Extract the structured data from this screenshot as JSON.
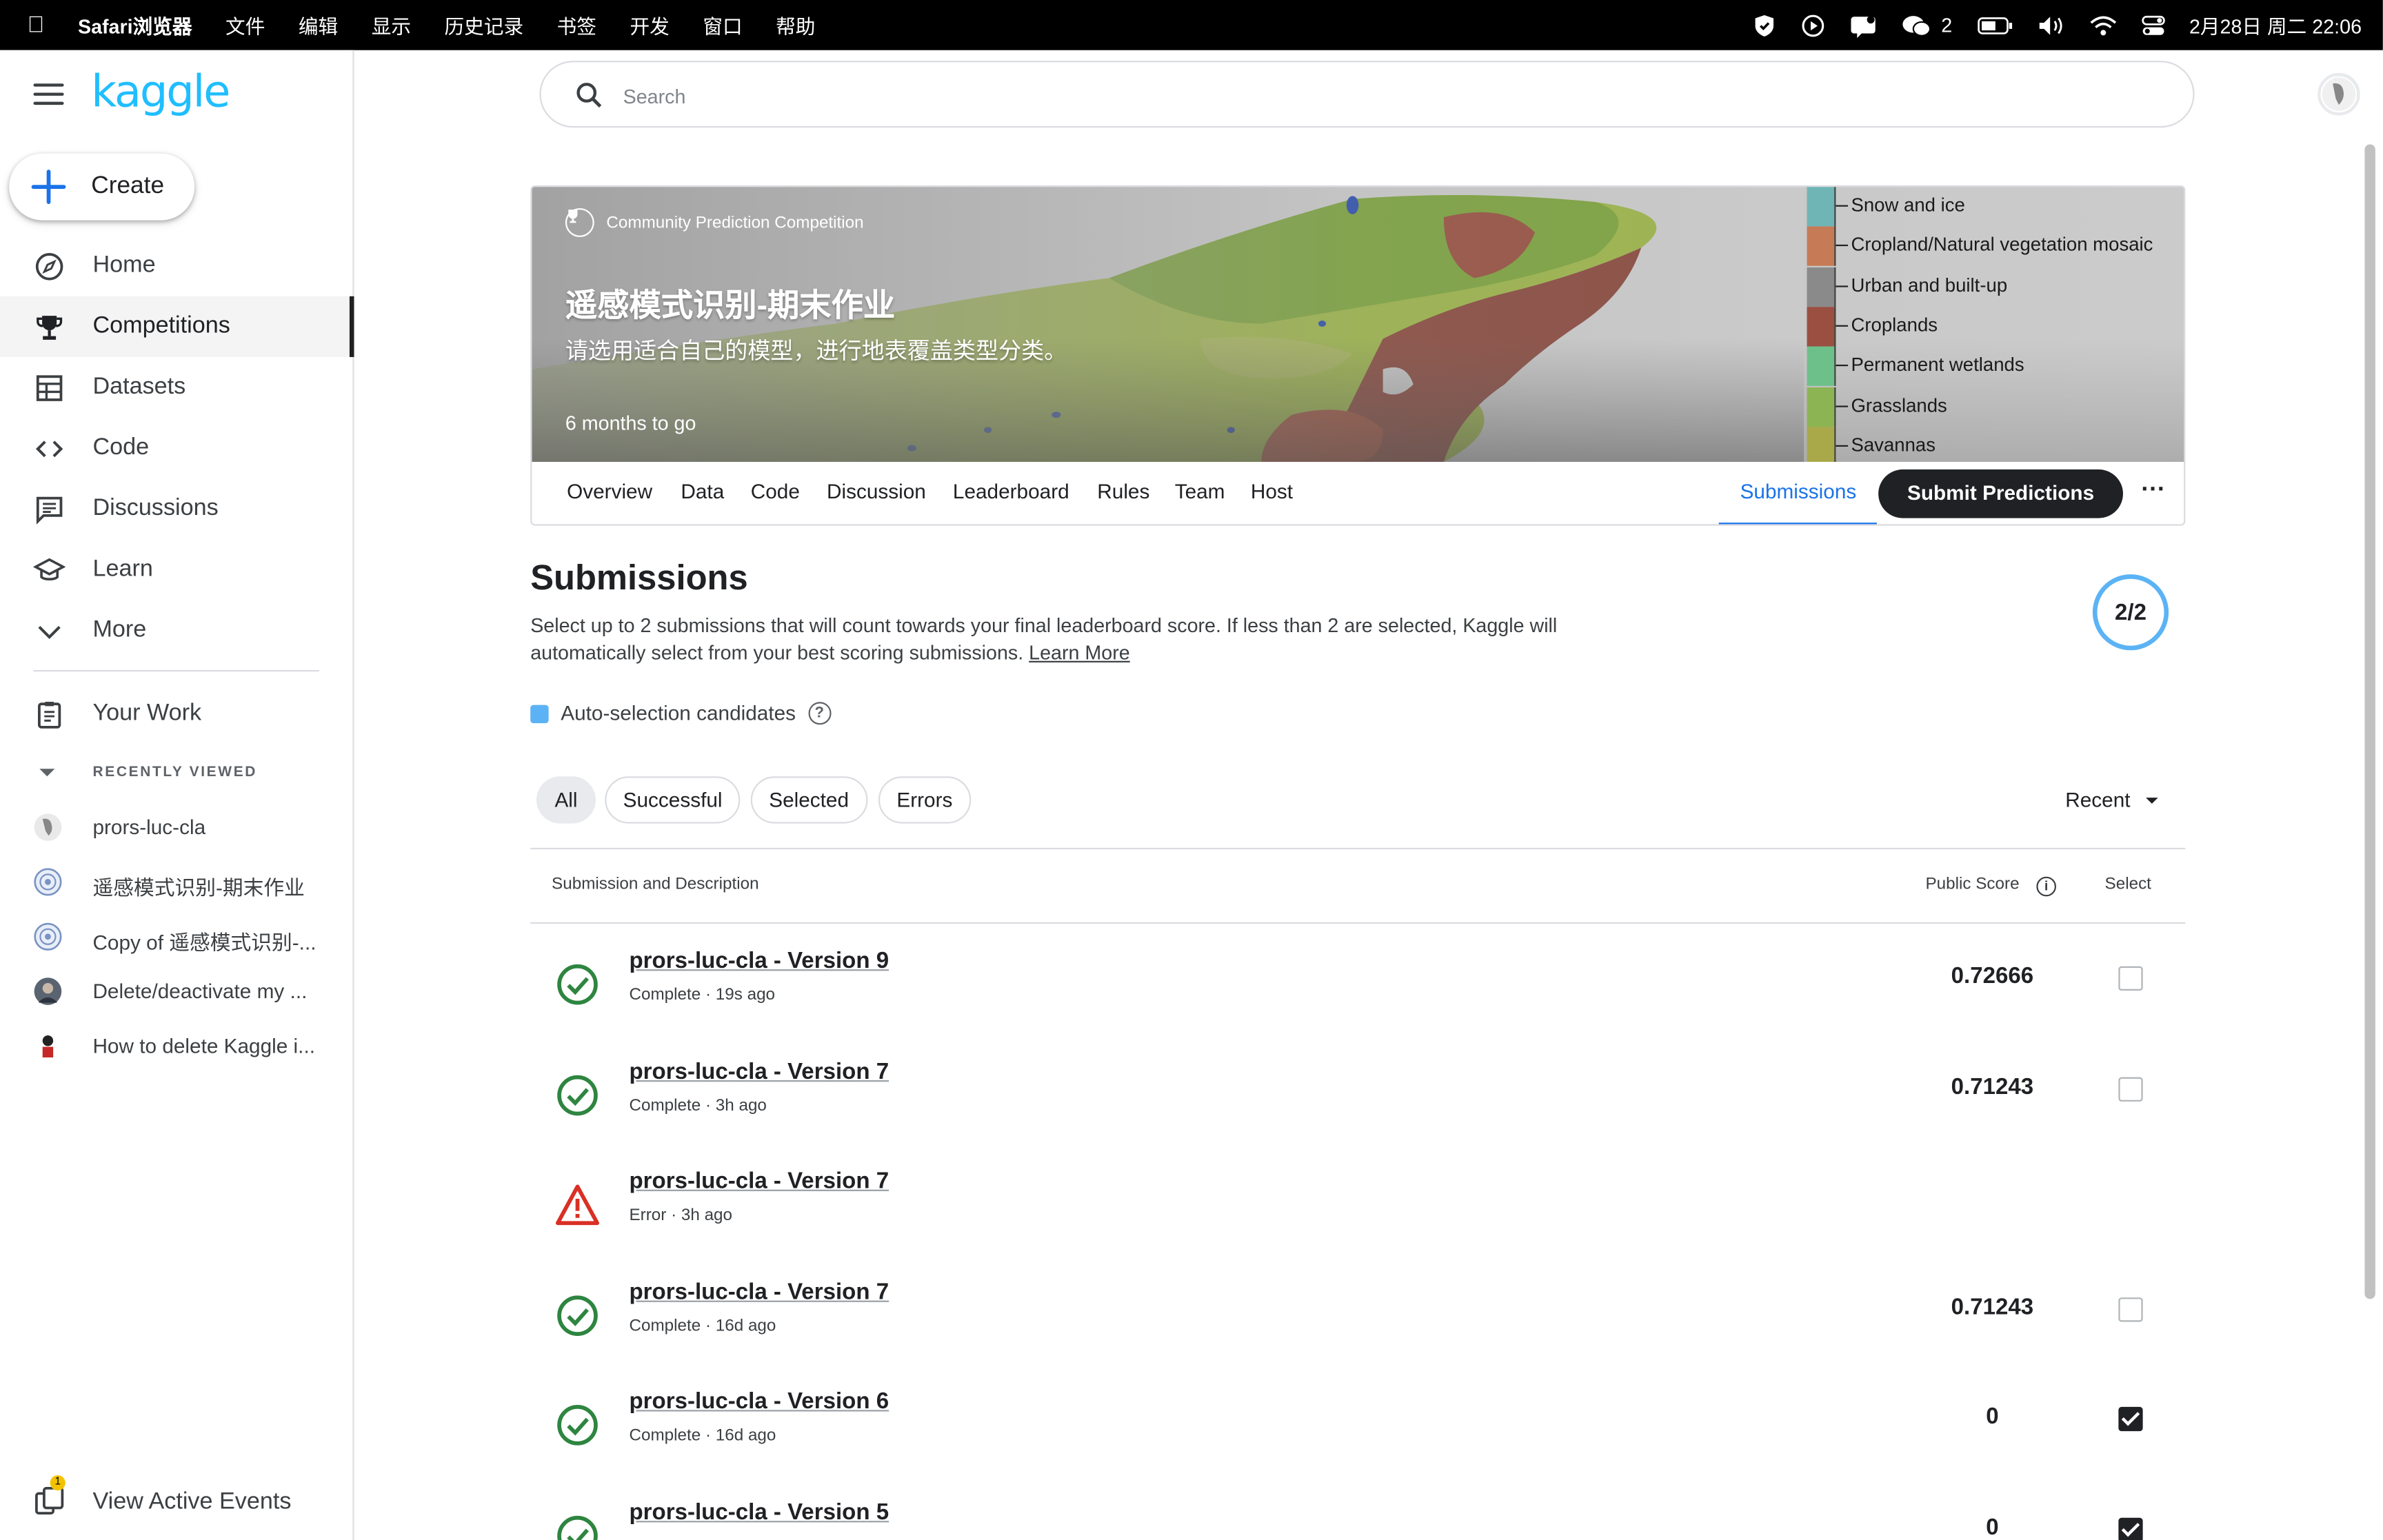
{
  "menubar": {
    "app": "Safari浏览器",
    "items": [
      "文件",
      "编辑",
      "显示",
      "历史记录",
      "书签",
      "开发",
      "窗口",
      "帮助"
    ],
    "wechat_badge": "2",
    "datetime": "2月28日 周二 22:06"
  },
  "sidebar": {
    "logo": "kaggle",
    "create_label": "Create",
    "nav": [
      {
        "label": "Home",
        "icon": "compass-icon"
      },
      {
        "label": "Competitions",
        "icon": "trophy-icon",
        "active": true
      },
      {
        "label": "Datasets",
        "icon": "table-icon"
      },
      {
        "label": "Code",
        "icon": "code-icon"
      },
      {
        "label": "Discussions",
        "icon": "chat-icon"
      },
      {
        "label": "Learn",
        "icon": "school-icon"
      },
      {
        "label": "More",
        "icon": "chevron-down-icon"
      }
    ],
    "your_work": "Your Work",
    "recently_viewed_heading": "RECENTLY VIEWED",
    "recent": [
      "prors-luc-cla",
      "遥感模式识别-期末作业",
      "Copy of 遥感模式识别-...",
      "Delete/deactivate my ...",
      "How to delete Kaggle i..."
    ],
    "view_active_events": "View Active Events",
    "events_badge": "1"
  },
  "search": {
    "placeholder": "Search"
  },
  "banner": {
    "type_label": "Community Prediction Competition",
    "title": "遥感模式识别-期末作业",
    "subtitle": "请选用适合自己的模型，进行地表覆盖类型分类。",
    "deadline": "6 months to go",
    "legend": [
      {
        "label": "Snow and ice",
        "color": "#6fb5b6"
      },
      {
        "label": "Cropland/Natural vegetation mosaic",
        "color": "#c57b56"
      },
      {
        "label": "Urban and built-up",
        "color": "#8a8a8a"
      },
      {
        "label": "Croplands",
        "color": "#9a4f40"
      },
      {
        "label": "Permanent wetlands",
        "color": "#6ec08a"
      },
      {
        "label": "Grasslands",
        "color": "#8db452"
      },
      {
        "label": "Savannas",
        "color": "#a9a94a"
      }
    ]
  },
  "tabs": {
    "items": [
      "Overview",
      "Data",
      "Code",
      "Discussion",
      "Leaderboard",
      "Rules",
      "Team",
      "Host"
    ],
    "active": "Submissions",
    "submit": "Submit Predictions"
  },
  "submissions": {
    "heading": "Submissions",
    "description": "Select up to 2 submissions that will count towards your final leaderboard score. If less than 2 are selected, Kaggle will automatically select from your best scoring submissions.",
    "learn_more": "Learn More",
    "selected_count": "2/2",
    "auto_selection": "Auto-selection candidates",
    "filters": [
      "All",
      "Successful",
      "Selected",
      "Errors"
    ],
    "sort": "Recent",
    "col_submission": "Submission and Description",
    "col_score": "Public Score",
    "col_select": "Select",
    "rows": [
      {
        "name": "prors-luc-cla - Version 9",
        "meta": "Complete · 19s ago",
        "score": "0.72666",
        "status": "complete",
        "selected": false
      },
      {
        "name": "prors-luc-cla - Version 7",
        "meta": "Complete · 3h ago",
        "score": "0.71243",
        "status": "complete",
        "selected": false
      },
      {
        "name": "prors-luc-cla - Version 7",
        "meta": "Error · 3h ago",
        "score": "",
        "status": "error",
        "selected": false
      },
      {
        "name": "prors-luc-cla - Version 7",
        "meta": "Complete · 16d ago",
        "score": "0.71243",
        "status": "complete",
        "selected": false
      },
      {
        "name": "prors-luc-cla - Version 6",
        "meta": "Complete · 16d ago",
        "score": "0",
        "status": "complete",
        "selected": true
      },
      {
        "name": "prors-luc-cla - Version 5",
        "meta": "",
        "score": "0",
        "status": "complete",
        "selected": true
      }
    ]
  },
  "colors": {
    "accent": "#20beff",
    "link": "#1a73e8",
    "success": "#2e8540",
    "error": "#d93025"
  }
}
